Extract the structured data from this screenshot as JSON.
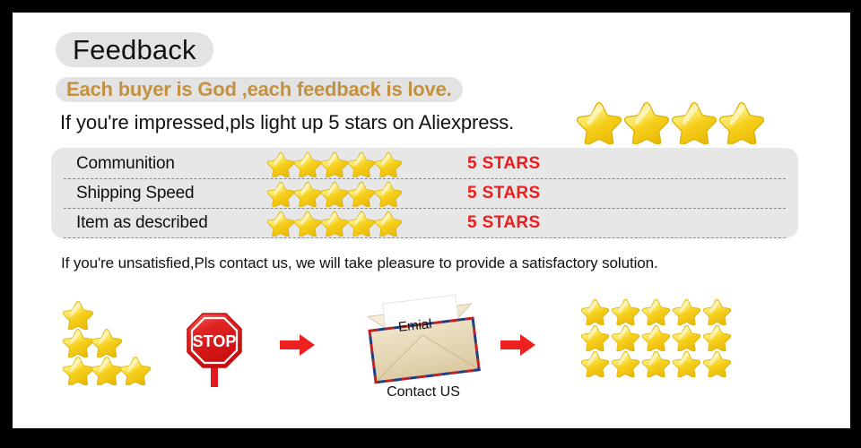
{
  "header": {
    "title": "Feedback",
    "tagline": "Each buyer is God ,each feedback is love.",
    "impressed_line": "If you're impressed,pls light up 5 stars on Aliexpress.",
    "top_star_count": 4
  },
  "ratings": {
    "rows": [
      {
        "label": "Communition",
        "stars": 5,
        "value": "5 STARS"
      },
      {
        "label": "Shipping Speed",
        "stars": 5,
        "value": "5 STARS"
      },
      {
        "label": "Item as described",
        "stars": 5,
        "value": "5 STARS"
      }
    ]
  },
  "footer": {
    "unsatisfied_line": "If you're unsatisfied,Pls contact us, we will take pleasure to provide a satisfactory solution."
  },
  "flow": {
    "bad_rating_stars": [
      1,
      2,
      3
    ],
    "stop_label": "STOP",
    "arrow_1": "right-arrow",
    "arrow_2": "right-arrow",
    "email": {
      "letter_text": "Emial",
      "caption": "Contact US"
    },
    "good_rating_grid": {
      "columns": 5,
      "rows": 3,
      "total": 15
    }
  },
  "colors": {
    "page_background": "#ffffff",
    "frame_border": "#000000",
    "pill_background": "#e3e3e3",
    "panel_background": "#e7e7e7",
    "tagline_text": "#c3913f",
    "stars_value_text": "#ee1c1c",
    "star_gold": "#f4cf20",
    "stop_red": "#e01b1b",
    "arrow_red": "#ef2020"
  },
  "icons": {
    "star": "star-icon",
    "stop_sign": "stop-sign-icon",
    "arrow": "right-arrow-icon",
    "envelope": "envelope-icon"
  }
}
